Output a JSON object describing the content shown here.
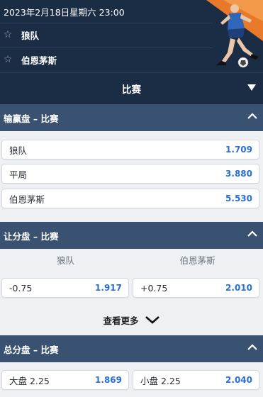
{
  "match": {
    "datetime": "2023年2月18日星期六 23:00",
    "home_team": "狼队",
    "away_team": "伯恩茅斯"
  },
  "sport_bar": {
    "title": "比赛"
  },
  "sections": {
    "moneyline": {
      "title": "输赢盘 – 比赛",
      "outcomes": [
        {
          "label": "狼队",
          "odds": "1.709"
        },
        {
          "label": "平局",
          "odds": "3.880"
        },
        {
          "label": "伯恩茅斯",
          "odds": "5.530"
        }
      ]
    },
    "handicap": {
      "title": "让分盘 – 比赛",
      "col_home": "狼队",
      "col_away": "伯恩茅斯",
      "home": {
        "line": "-0.75",
        "odds": "1.917"
      },
      "away": {
        "line": "+0.75",
        "odds": "2.010"
      },
      "see_more": "查看更多"
    },
    "totals": {
      "title": "总分盘 – 比赛",
      "over": {
        "label": "大盘 2.25",
        "odds": "1.869"
      },
      "under": {
        "label": "小盘 2.25",
        "odds": "2.040"
      }
    }
  },
  "colors": {
    "header_bg": "#1b2c45",
    "section_bg": "#3a5271",
    "odds_blue": "#2a6fd6",
    "accent_orange": "#e8782a"
  },
  "icons": [
    "star-icon",
    "caret-down-icon",
    "chevron-up-icon",
    "chevron-down-icon"
  ]
}
